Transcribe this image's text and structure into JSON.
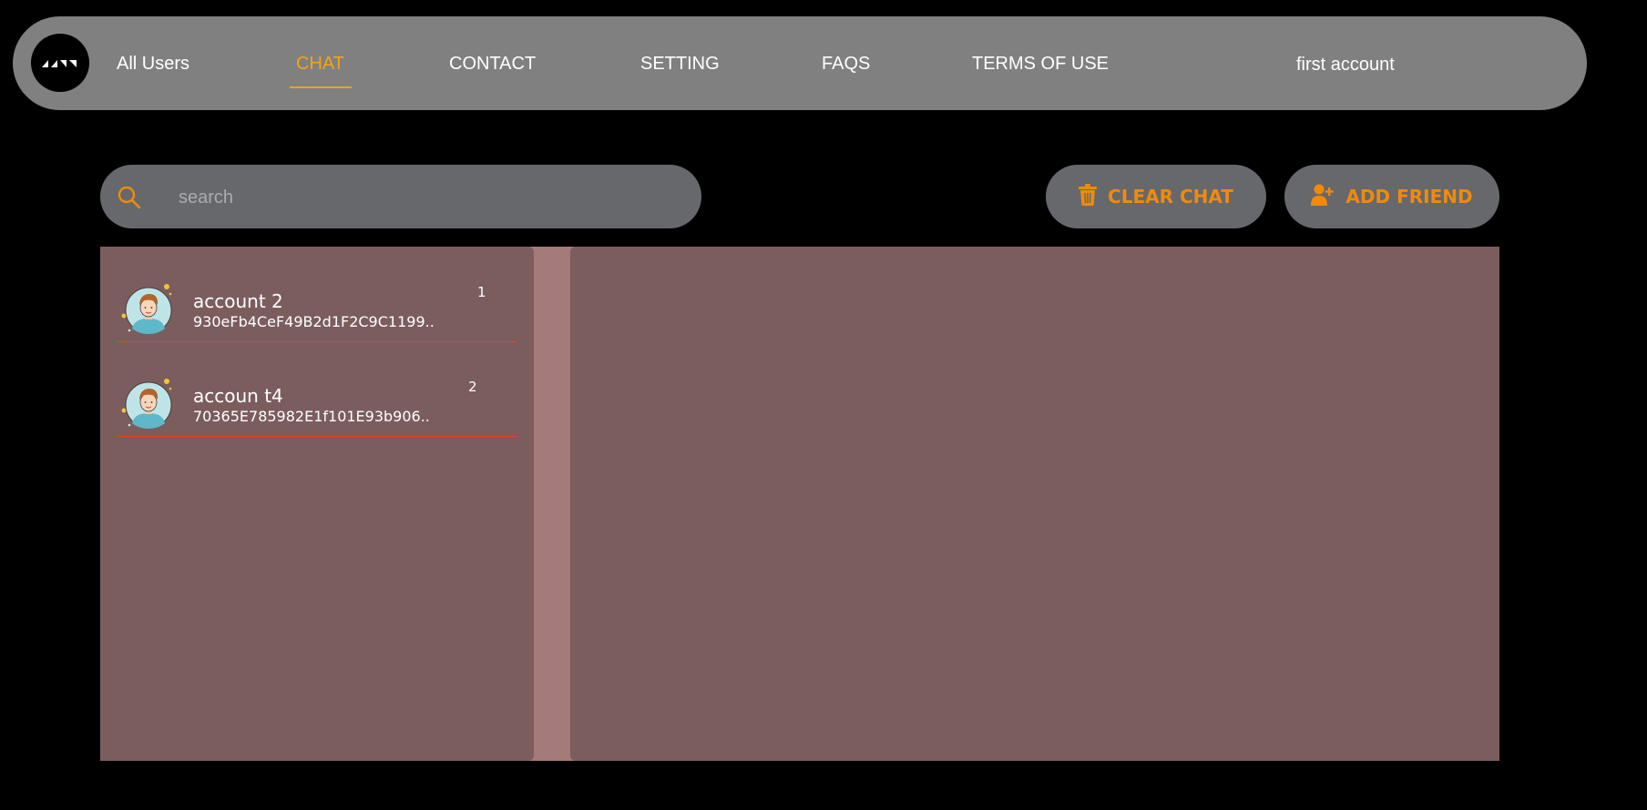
{
  "nav": {
    "items": [
      {
        "label": "All Users"
      },
      {
        "label": "CHAT",
        "active": true
      },
      {
        "label": "CONTACT"
      },
      {
        "label": "SETTING"
      },
      {
        "label": "FAQS"
      },
      {
        "label": "TERMS OF USE"
      }
    ],
    "account_label": "first account"
  },
  "search": {
    "placeholder": "search",
    "value": ""
  },
  "toolbar": {
    "clear_label": "CLEAR CHAT",
    "add_label": "ADD FRIEND"
  },
  "contacts": [
    {
      "name": "account 2",
      "address": "930eFb4CeF49B2d1F2C9C1199..",
      "count": "1"
    },
    {
      "name": "accoun t4",
      "address": "70365E785982E1f101E93b906..",
      "count": "2"
    }
  ],
  "colors": {
    "accent": "#f5a21a",
    "button_text": "#f08a0c",
    "navbar": "#808080",
    "panel": "#7b5d5e",
    "divider": "#e4471f"
  },
  "icons": {
    "logo": "logo-icon",
    "search": "search-icon",
    "clear": "trash-icon",
    "add": "user-plus-icon",
    "avatar": "avatar-icon"
  }
}
